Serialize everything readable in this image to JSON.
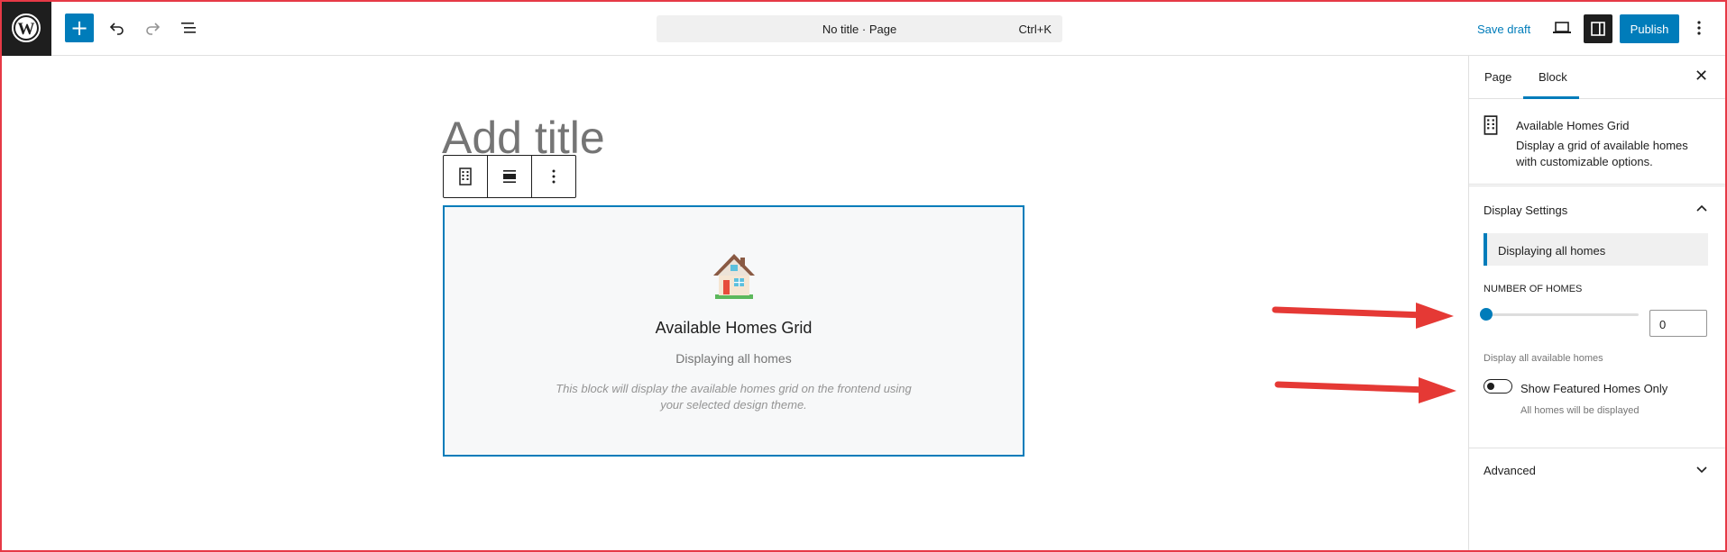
{
  "header": {
    "command_bar_title": "No title · Page",
    "command_bar_shortcut": "Ctrl+K",
    "save_draft_label": "Save draft",
    "publish_label": "Publish"
  },
  "editor": {
    "title_placeholder": "Add title",
    "block": {
      "heading": "Available Homes Grid",
      "subtitle": "Displaying all homes",
      "note": "This block will display the available homes grid on the frontend using your selected design theme."
    }
  },
  "sidebar": {
    "tabs": [
      {
        "label": "Page"
      },
      {
        "label": "Block"
      }
    ],
    "active_tab": "Block",
    "block_card": {
      "title": "Available Homes Grid",
      "description": "Display a grid of available homes with customizable options."
    },
    "display_settings": {
      "heading": "Display Settings",
      "notice": "Displaying all homes",
      "number_label": "NUMBER OF HOMES",
      "number_value": "0",
      "slider_value": 0,
      "number_help": "Display all available homes",
      "toggle_label": "Show Featured Homes Only",
      "toggle_on": false,
      "toggle_help": "All homes will be displayed"
    },
    "advanced": {
      "heading": "Advanced"
    }
  },
  "colors": {
    "accent": "#007cba",
    "annotation_arrow": "#e53935",
    "frame_border": "#e63946"
  }
}
